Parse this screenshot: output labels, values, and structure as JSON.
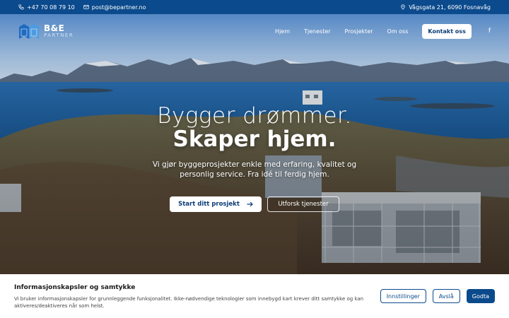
{
  "topbar": {
    "phone": "+47 70 08 79 10",
    "email": "post@bepartner.no",
    "address": "Vågsgata 21, 6090 Fosnavåg"
  },
  "nav": {
    "logo_main": "B&E",
    "logo_sub": "PARTNER",
    "items": [
      {
        "label": "Hjem"
      },
      {
        "label": "Tjenester"
      },
      {
        "label": "Prosjekter"
      },
      {
        "label": "Om oss"
      }
    ],
    "cta": "Kontakt oss",
    "social_icon": "facebook-icon"
  },
  "hero": {
    "title_line1": "Bygger drømmer.",
    "title_line2": "Skaper hjem.",
    "subtitle": "Vi gjør byggeprosjekter enkle med erfaring, kvalitet og personlig service. Fra idé til ferdig hjem.",
    "primary_button": "Start ditt prosjekt",
    "primary_icon": "arrow-right-icon",
    "secondary_button": "Utforsk tjenester"
  },
  "cookie": {
    "title": "Informasjonskapsler og samtykke",
    "text": "Vi bruker informasjonskapsler for grunnleggende funksjonalitet. Ikke-nødvendige teknologier som innebygd kart krever ditt samtykke og kan aktiveres/deaktiveres når som helst.",
    "settings": "Innstillinger",
    "decline": "Avslå",
    "accept": "Godta"
  },
  "colors": {
    "brand_blue": "#0b4a8c",
    "dark_blue": "#0b3d78"
  }
}
